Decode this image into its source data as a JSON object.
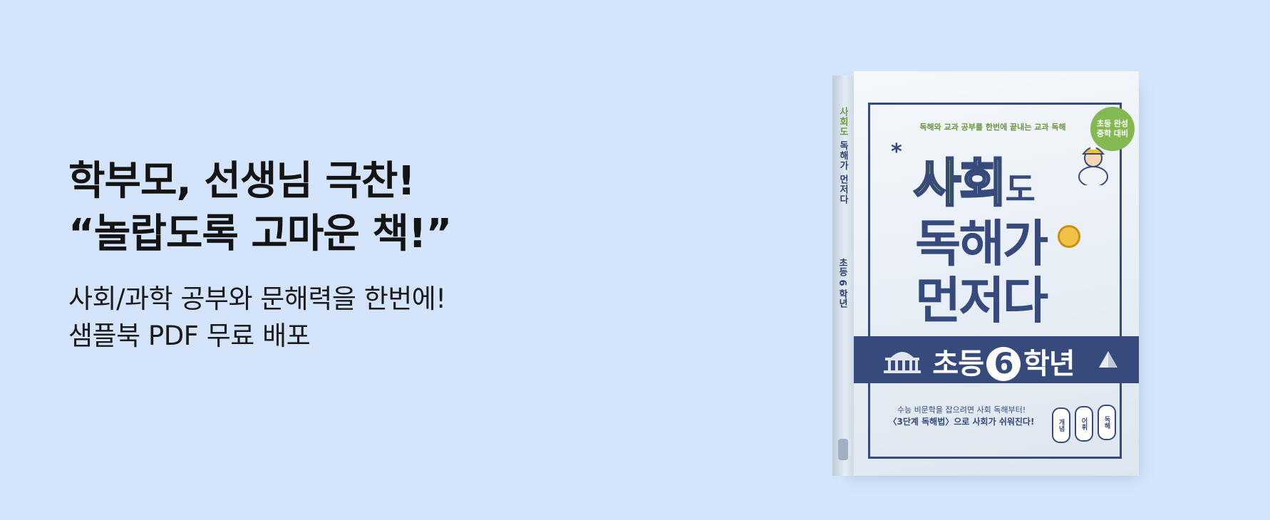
{
  "headline": {
    "line1": "학부모, 선생님 극찬!",
    "line2": "“놀랍도록 고마운 책!”"
  },
  "subtext": {
    "line1": "사회/과학 공부와 문해력을 한번에!",
    "line2": "샘플북 PDF 무료 배포"
  },
  "book": {
    "spine_title_part1": "사회도",
    "spine_title_part2": " 독해가 먼저다",
    "spine_grade": "초등 6 학년",
    "tagline": "독해와 교과 공부를 한번에 끝내는 교과 독해",
    "badge_line1": "초등 완성",
    "badge_line2": "중학 대비",
    "title_part1": "사회",
    "title_part2": "도",
    "title_line2": "독해가",
    "title_line3": "먼저다",
    "grade_prefix": "초등",
    "grade_number": "6",
    "grade_suffix": "학년",
    "note_line1": "수능 비문학을 잡으려면 사회 독해부터!",
    "note_line2": "〈3단계 독해법〉으로 사회가 쉬워진다!",
    "pills": [
      "개념",
      "어휘",
      "독해"
    ]
  },
  "colors": {
    "background": "#d4e5fb",
    "book_navy": "#364a7c",
    "book_green": "#8bc04f"
  }
}
